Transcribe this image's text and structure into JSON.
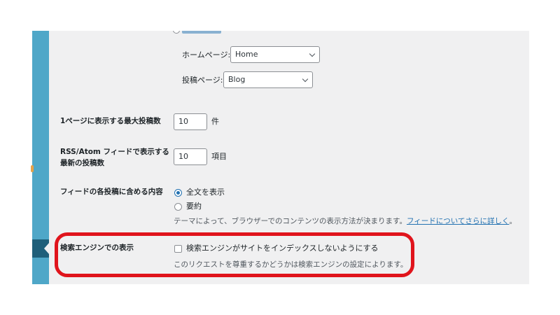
{
  "reading": {
    "homepage_label": "ホームページ:",
    "homepage_value": "Home",
    "posts_page_label": "投稿ページ:",
    "posts_page_value": "Blog",
    "posts_per_page_label": "1ページに表示する最大投稿数",
    "posts_per_page_value": "10",
    "posts_per_page_unit": "件",
    "rss_label_line1": "RSS/Atom フィードで表示する",
    "rss_label_line2": "最新の投稿数",
    "rss_value": "10",
    "rss_unit": "項目",
    "feed_content_label": "フィードの各投稿に含める内容",
    "feed_full_text": "全文を表示",
    "feed_excerpt": "要約",
    "feed_help_text": "テーマによって、ブラウザーでのコンテンツの表示方法が決まります。",
    "feed_help_link": "フィードについてさらに詳しく",
    "feed_help_end": "。",
    "search_label": "検索エンジンでの表示",
    "search_checkbox_label": "検索エンジンがサイトをインデックスしないようにする",
    "search_help": "このリクエストを尊重するかどうかは検索エンジンの設定によります。"
  },
  "colors": {
    "accent": "#2271b1",
    "highlight": "#e0141c",
    "sidebar": "#4fa7c8",
    "background": "#f0f0f1"
  }
}
